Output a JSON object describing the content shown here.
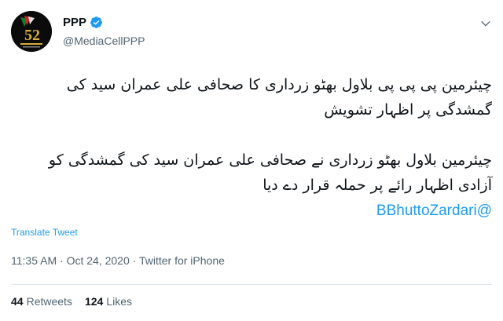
{
  "author": {
    "name": "PPP",
    "handle": "@MediaCellPPP",
    "avatar_text": "52",
    "verified": true
  },
  "tweet": {
    "lines1": [
      "چیئرمین پی پی پی بلاول بھٹو زرداری کا صحافی علی عمران سید کی",
      "گمشدگی پر اظہار تشویش"
    ],
    "lines2": [
      "چیئرمین بلاول بھٹو زرداری نے صحافی علی عمران سید کی گمشدگی کو",
      "آزادی اظہار رائے پر حملہ قرار دے دیا"
    ],
    "mention": "@BBhuttoZardari"
  },
  "translate_label": "Translate Tweet",
  "meta": {
    "time": "11:35 AM",
    "date": "Oct 24, 2020",
    "source": "Twitter for iPhone"
  },
  "stats": {
    "retweets_count": "44",
    "retweets_label": "Retweets",
    "likes_count": "124",
    "likes_label": "Likes"
  },
  "colors": {
    "accent": "#1d9bf0",
    "text": "#0f1419",
    "muted": "#536471"
  },
  "icons": [
    "verified-badge-icon",
    "chevron-down-icon"
  ]
}
